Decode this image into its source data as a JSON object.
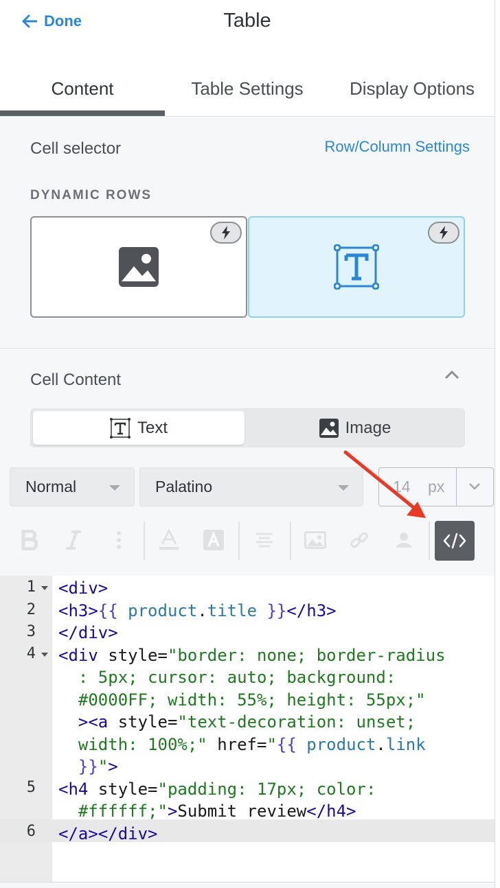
{
  "header": {
    "back_label": "Done",
    "title": "Table"
  },
  "tabs": [
    {
      "label": "Content",
      "active": true
    },
    {
      "label": "Table Settings",
      "active": false
    },
    {
      "label": "Display Options",
      "active": false
    }
  ],
  "cell_selector": {
    "label": "Cell selector",
    "link": "Row/Column Settings",
    "dynamic_rows_label": "DYNAMIC ROWS",
    "cards": [
      {
        "icon": "image-icon",
        "selected": false
      },
      {
        "icon": "text-icon",
        "selected": true
      }
    ]
  },
  "cell_content": {
    "label": "Cell Content",
    "segment": [
      {
        "label": "Text",
        "icon": "text-icon",
        "selected": true
      },
      {
        "label": "Image",
        "icon": "image-icon",
        "selected": false
      }
    ]
  },
  "format": {
    "style_value": "Normal",
    "font_value": "Palatino",
    "size_value": "14",
    "size_unit": "px"
  },
  "toolbar": {
    "buttons": [
      "bold-icon",
      "italic-icon",
      "more-icon",
      "text-color-icon",
      "highlight-icon",
      "align-icon",
      "insert-image-icon",
      "link-icon",
      "person-icon",
      "code-view-icon"
    ],
    "active": "code-view-icon"
  },
  "editor": {
    "line_numbers": [
      "1",
      "2",
      "3",
      "4",
      "5",
      "6"
    ],
    "active_line": "6"
  },
  "colors": {
    "accent": "#2b87d3",
    "arrow": "#e83a26",
    "selected_card_bg": "#e1f4fc"
  }
}
